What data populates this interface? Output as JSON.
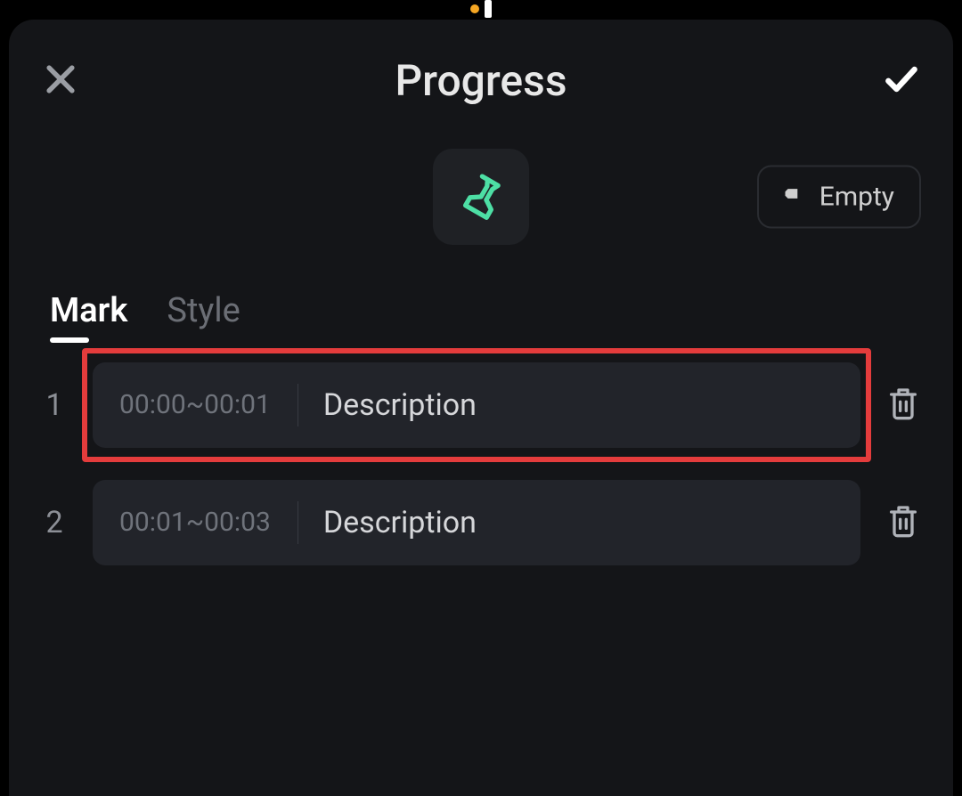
{
  "header": {
    "title": "Progress"
  },
  "toolbar": {
    "empty_label": "Empty"
  },
  "tabs": {
    "mark": "Mark",
    "style": "Style"
  },
  "rows": [
    {
      "index": "1",
      "time": "00:00~00:01",
      "desc": "Description",
      "highlighted": true
    },
    {
      "index": "2",
      "time": "00:01~00:03",
      "desc": "Description",
      "highlighted": false
    }
  ],
  "colors": {
    "accent": "#4ddfa5",
    "highlight": "#e43c3c",
    "bg": "#141518",
    "card": "#22242a"
  }
}
